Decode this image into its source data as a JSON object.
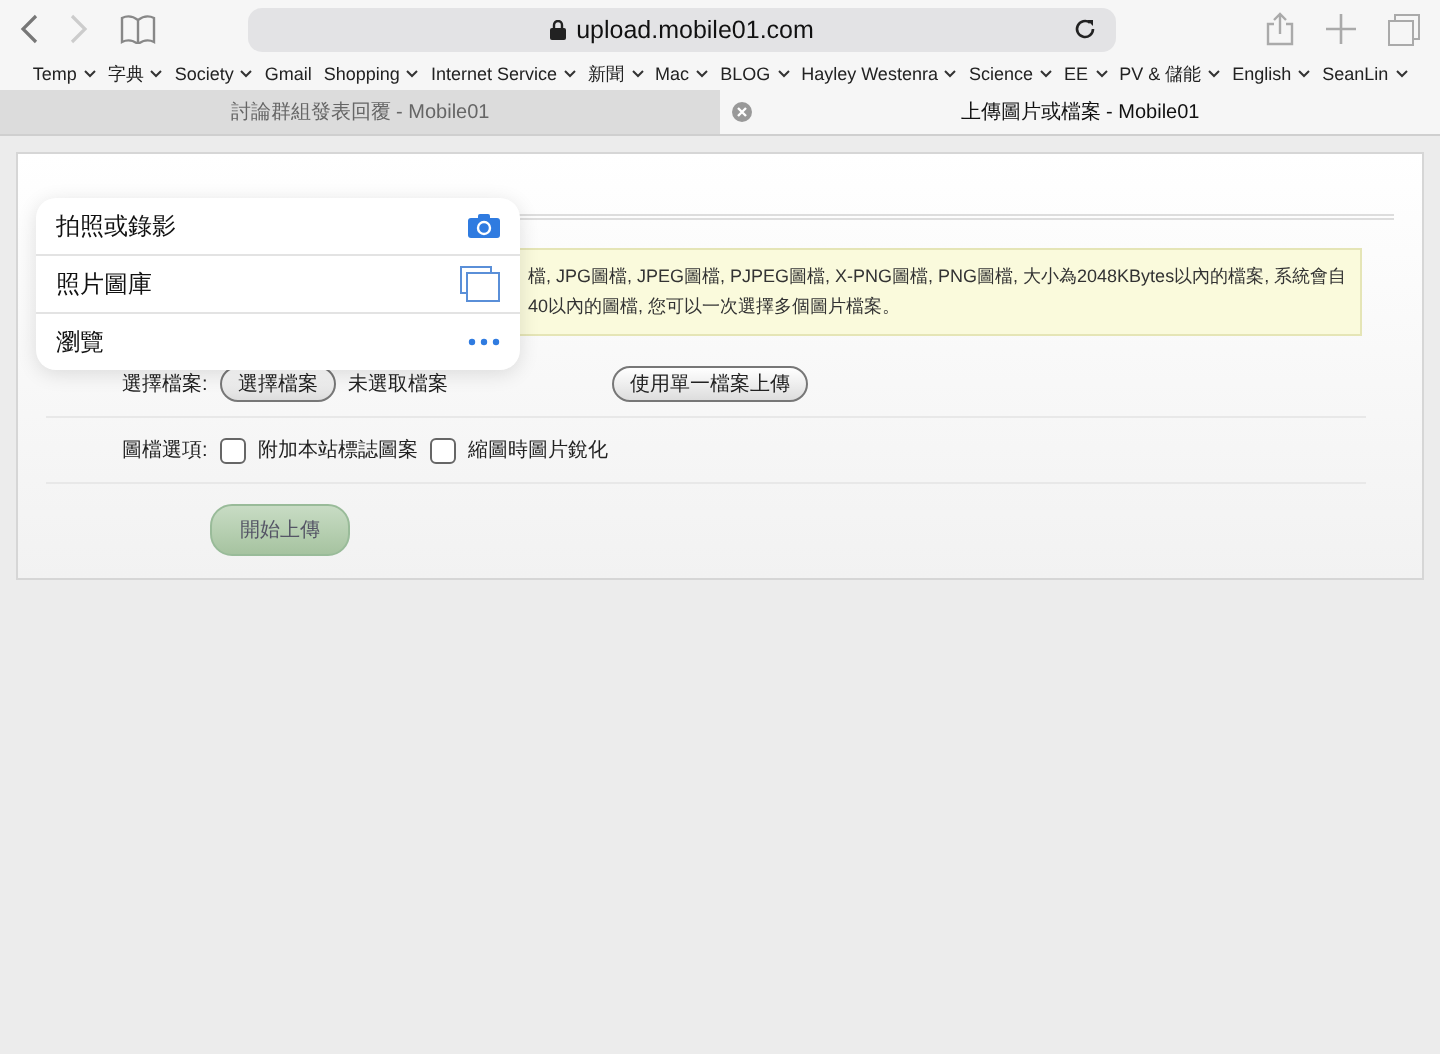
{
  "address_bar": {
    "url": "upload.mobile01.com"
  },
  "bookmarks": [
    {
      "label": "Temp",
      "menu": true
    },
    {
      "label": "字典",
      "menu": true
    },
    {
      "label": "Society",
      "menu": true
    },
    {
      "label": "Gmail",
      "menu": false
    },
    {
      "label": "Shopping",
      "menu": true
    },
    {
      "label": "Internet Service",
      "menu": true
    },
    {
      "label": "新聞",
      "menu": true
    },
    {
      "label": "Mac",
      "menu": true
    },
    {
      "label": "BLOG",
      "menu": true
    },
    {
      "label": "Hayley Westenra",
      "menu": true
    },
    {
      "label": "Science",
      "menu": true
    },
    {
      "label": "EE",
      "menu": true
    },
    {
      "label": "PV & 儲能",
      "menu": true
    },
    {
      "label": "English",
      "menu": true
    },
    {
      "label": "SeanLin",
      "menu": true
    }
  ],
  "tabs": [
    {
      "title": "討論群組發表回覆 - Mobile01",
      "selected": false
    },
    {
      "title": "上傳圖片或檔案 - Mobile01",
      "selected": true
    }
  ],
  "page": {
    "notice": [
      "檔, JPG圖檔, JPEG圖檔, PJPEG圖檔, X-PNG圖檔, PNG圖檔, 大小為2048KBytes以內的檔案, 系統會自",
      "40以內的圖檔, 您可以一次選擇多個圖片檔案。"
    ],
    "file_label": "選擇檔案:",
    "file_button": "選擇檔案",
    "file_status": "未選取檔案",
    "single_button": "使用單一檔案上傳",
    "options_label": "圖檔選項:",
    "options": [
      {
        "label": "附加本站標誌圖案",
        "checked": false
      },
      {
        "label": "縮圖時圖片銳化",
        "checked": false
      }
    ],
    "submit": "開始上傳"
  },
  "popover": [
    {
      "label": "拍照或錄影",
      "kind": "camera"
    },
    {
      "label": "照片圖庫",
      "kind": "library"
    },
    {
      "label": "瀏覽",
      "kind": "more"
    }
  ]
}
